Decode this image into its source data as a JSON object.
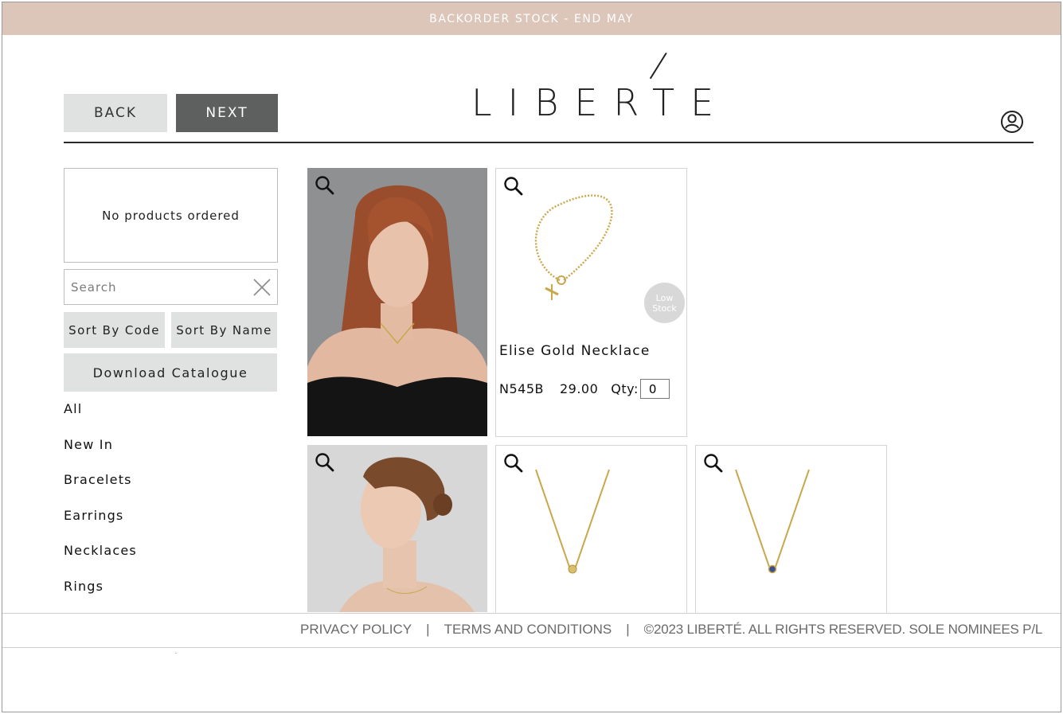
{
  "banner": {
    "text": "BACKORDER STOCK - END MAY"
  },
  "header": {
    "back_label": "BACK",
    "next_label": "NEXT",
    "logo_text": "LIBERTE",
    "user_icon": "user-circle-icon"
  },
  "sidebar": {
    "order_summary": "No products ordered",
    "search": {
      "placeholder": "Search",
      "value": ""
    },
    "sort_by_code_label": "Sort By Code",
    "sort_by_name_label": "Sort By Name",
    "download_label": "Download Catalogue",
    "categories": [
      "All",
      "New In",
      "Bracelets",
      "Earrings",
      "Necklaces",
      "Rings"
    ]
  },
  "products": [
    {
      "name": "Elise Gold Necklace",
      "code": "N545B",
      "price": "29.00",
      "qty_label": "Qty:",
      "qty": "0",
      "badge": "Low Stock"
    }
  ],
  "footer": {
    "privacy": "PRIVACY POLICY",
    "separator": "|",
    "terms": "TERMS AND CONDITIONS",
    "copyright": "©2023 LIBERTÉ. ALL RIGHTS RESERVED. SOLE NOMINEES P/L"
  },
  "colors": {
    "banner": "#dcc5b9",
    "button_light": "#e0e1e1",
    "button_dark": "#5e5f5f",
    "gold": "#c9a84c"
  }
}
